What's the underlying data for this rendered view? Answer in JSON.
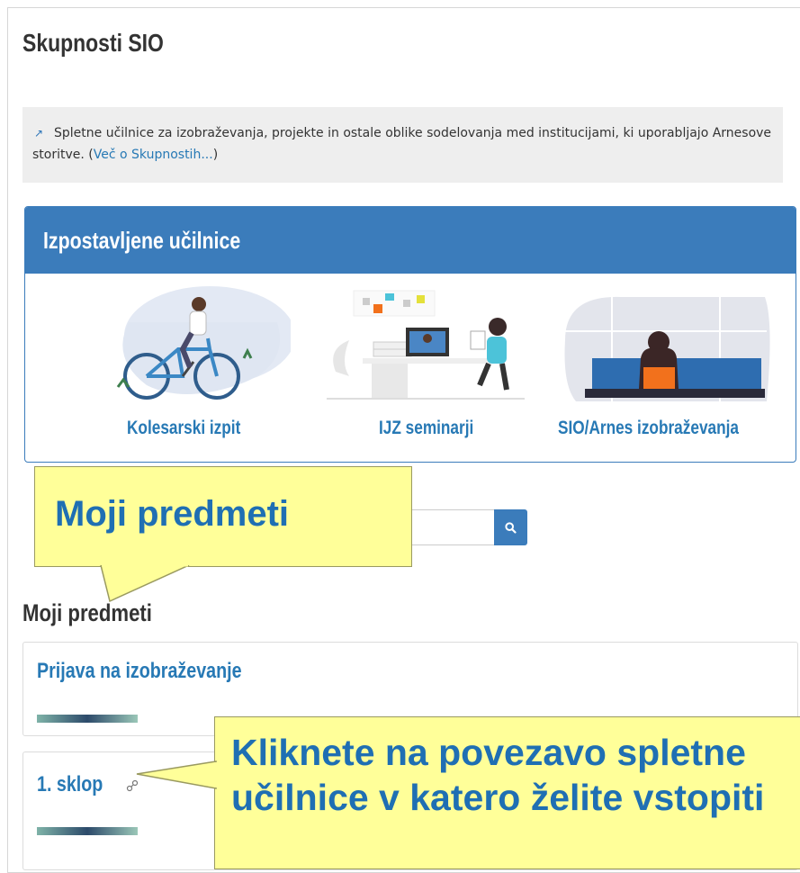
{
  "page": {
    "title": "Skupnosti SIO"
  },
  "info": {
    "text": "Spletne učilnice za izobraževanja, projekte in ostale oblike sodelovanja med institucijami, ki uporabljajo Arnesove storitve. (",
    "link": "Več o Skupnostih...",
    "suffix": ")"
  },
  "featured": {
    "title": "Izpostavljene učilnice",
    "courses": [
      {
        "label": "Kolesarski izpit"
      },
      {
        "label": "IJZ seminarji"
      },
      {
        "label": "SIO/Arnes izobraževanja"
      }
    ]
  },
  "search": {
    "icon": "search-icon"
  },
  "my_courses": {
    "heading": "Moji predmeti",
    "items": [
      {
        "name": "Prijava na izobraževanje"
      },
      {
        "name": "1. sklop"
      }
    ]
  },
  "callouts": {
    "first": "Moji predmeti",
    "second_line1": "Kliknete na povezavo spletne",
    "second_line2": "učilnice v katero želite vstopiti"
  },
  "colors": {
    "accent": "#3b7cbb",
    "link": "#2779b5",
    "callout": "#ffff99"
  }
}
